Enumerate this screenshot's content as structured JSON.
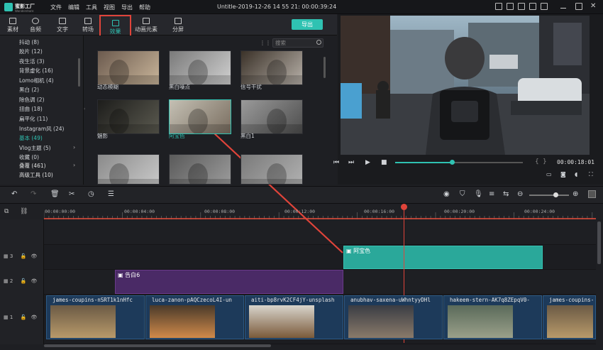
{
  "app": {
    "name": "蜜影工厂",
    "sub": "Wondershare"
  },
  "menu": [
    "文件",
    "编辑",
    "工具",
    "视图",
    "导出",
    "帮助"
  ],
  "document_title": "Untitle-2019-12-26 14 55 21: 00:00:39:24",
  "tabs": [
    {
      "label": "素材",
      "active": false
    },
    {
      "label": "音频",
      "active": false
    },
    {
      "label": "文字",
      "active": false
    },
    {
      "label": "转场",
      "active": false
    },
    {
      "label": "效果",
      "active": true
    },
    {
      "label": "动画元素",
      "active": false
    },
    {
      "label": "分屏",
      "active": false
    }
  ],
  "export_label": "导出",
  "sidebar": {
    "items": [
      {
        "label": "抖动 (8)"
      },
      {
        "label": "胶片 (12)"
      },
      {
        "label": "夜生活 (3)"
      },
      {
        "label": "背景虚化 (16)"
      },
      {
        "label": "Lomo相机 (4)"
      },
      {
        "label": "黑白 (2)"
      },
      {
        "label": "除色调 (2)"
      },
      {
        "label": "扭曲 (18)"
      },
      {
        "label": "扁平化 (11)"
      },
      {
        "label": "Instagram风 (24)"
      },
      {
        "label": "基本 (49)",
        "selected": true
      },
      {
        "label": "Vlog主题 (5)"
      },
      {
        "label": "收藏 (0)"
      }
    ],
    "groups": [
      {
        "label": "叠覆 (461)"
      },
      {
        "label": "高级工具 (10)"
      }
    ]
  },
  "search": {
    "placeholder": "搜索"
  },
  "effects": [
    {
      "label": "动态模糊"
    },
    {
      "label": "黑白噪点"
    },
    {
      "label": "信号干扰"
    },
    {
      "label": "魅影"
    },
    {
      "label": "阿宝色",
      "selected": true
    },
    {
      "label": "黑白1"
    },
    {
      "label": ""
    },
    {
      "label": ""
    },
    {
      "label": ""
    }
  ],
  "player": {
    "timecode": "00:00:18:01",
    "progress": 0.44
  },
  "ruler": [
    "00:00:00:00",
    "00:00:04:00",
    "00:00:08:00",
    "00:00:12:00",
    "00:00:16:00",
    "00:00:20:00",
    "00:00:24:00"
  ],
  "tracks": [
    {
      "id": "3"
    },
    {
      "id": "2"
    },
    {
      "id": "1"
    }
  ],
  "clips": {
    "effect": "阿宝色",
    "title": "告白6",
    "video": [
      "james-coupins-nSRT1k1nHfc",
      "luca-zanon-pAQCzecoL4I-un",
      "aiti-bp8rvK2CF4jY-unsplash",
      "anubhav-saxena-uWhntyyDHl",
      "hakeem-stern-AK7q8ZEpqV0-",
      "james-coupins-"
    ]
  },
  "colors": {
    "accent": "#2fc2b2",
    "effect_clip": "#2aa89a",
    "title_clip": "#4a2a66",
    "playhead": "#e0443a"
  }
}
